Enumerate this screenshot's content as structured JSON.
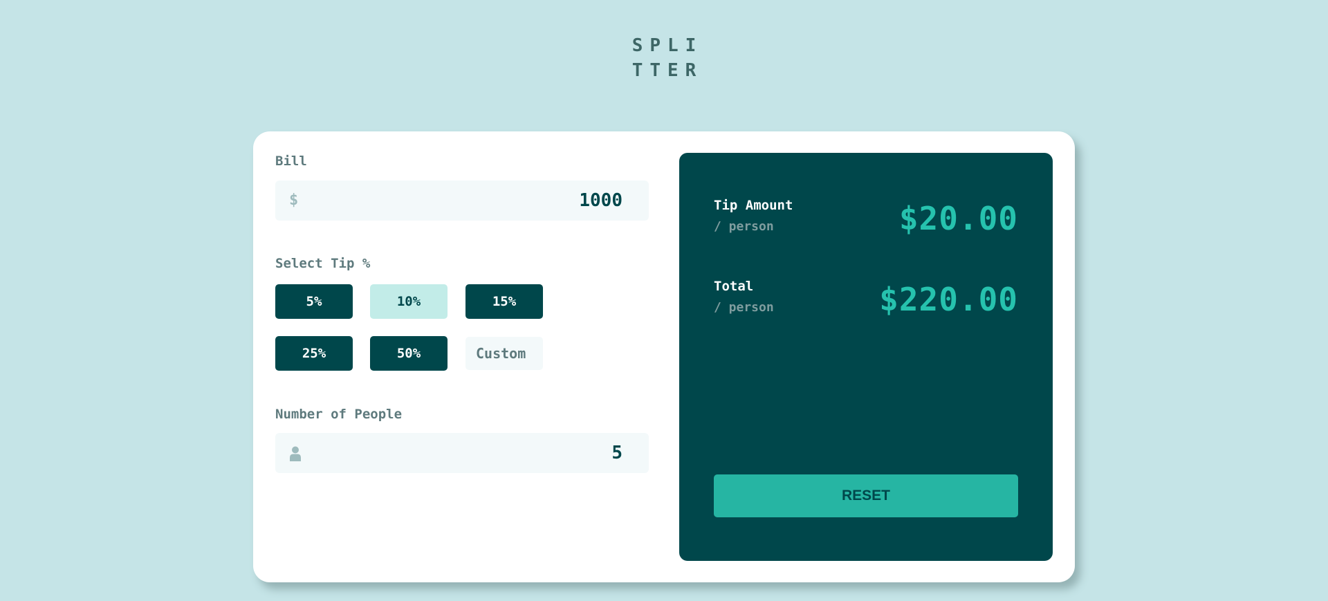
{
  "logo": {
    "line1": "SPLI",
    "line2": "TTER"
  },
  "bill": {
    "label": "Bill",
    "currency_symbol": "$",
    "value": "1000"
  },
  "tip": {
    "label": "Select Tip %",
    "options": [
      {
        "label": "5%",
        "selected": false
      },
      {
        "label": "10%",
        "selected": true
      },
      {
        "label": "15%",
        "selected": false
      },
      {
        "label": "25%",
        "selected": false
      },
      {
        "label": "50%",
        "selected": false
      }
    ],
    "custom_placeholder": "Custom"
  },
  "people": {
    "label": "Number of People",
    "icon": "person-icon",
    "value": "5"
  },
  "results": {
    "tip_amount": {
      "title": "Tip Amount",
      "sub": "/ person",
      "value": "$20.00"
    },
    "total": {
      "title": "Total",
      "sub": "/ person",
      "value": "$220.00"
    },
    "reset_label": "RESET"
  },
  "colors": {
    "background": "#c5e4e7",
    "dark_cyan": "#00474b",
    "strong_cyan": "#26c2ae",
    "selected_tip": "#c2ece8",
    "input_bg": "#f3f9fa"
  }
}
